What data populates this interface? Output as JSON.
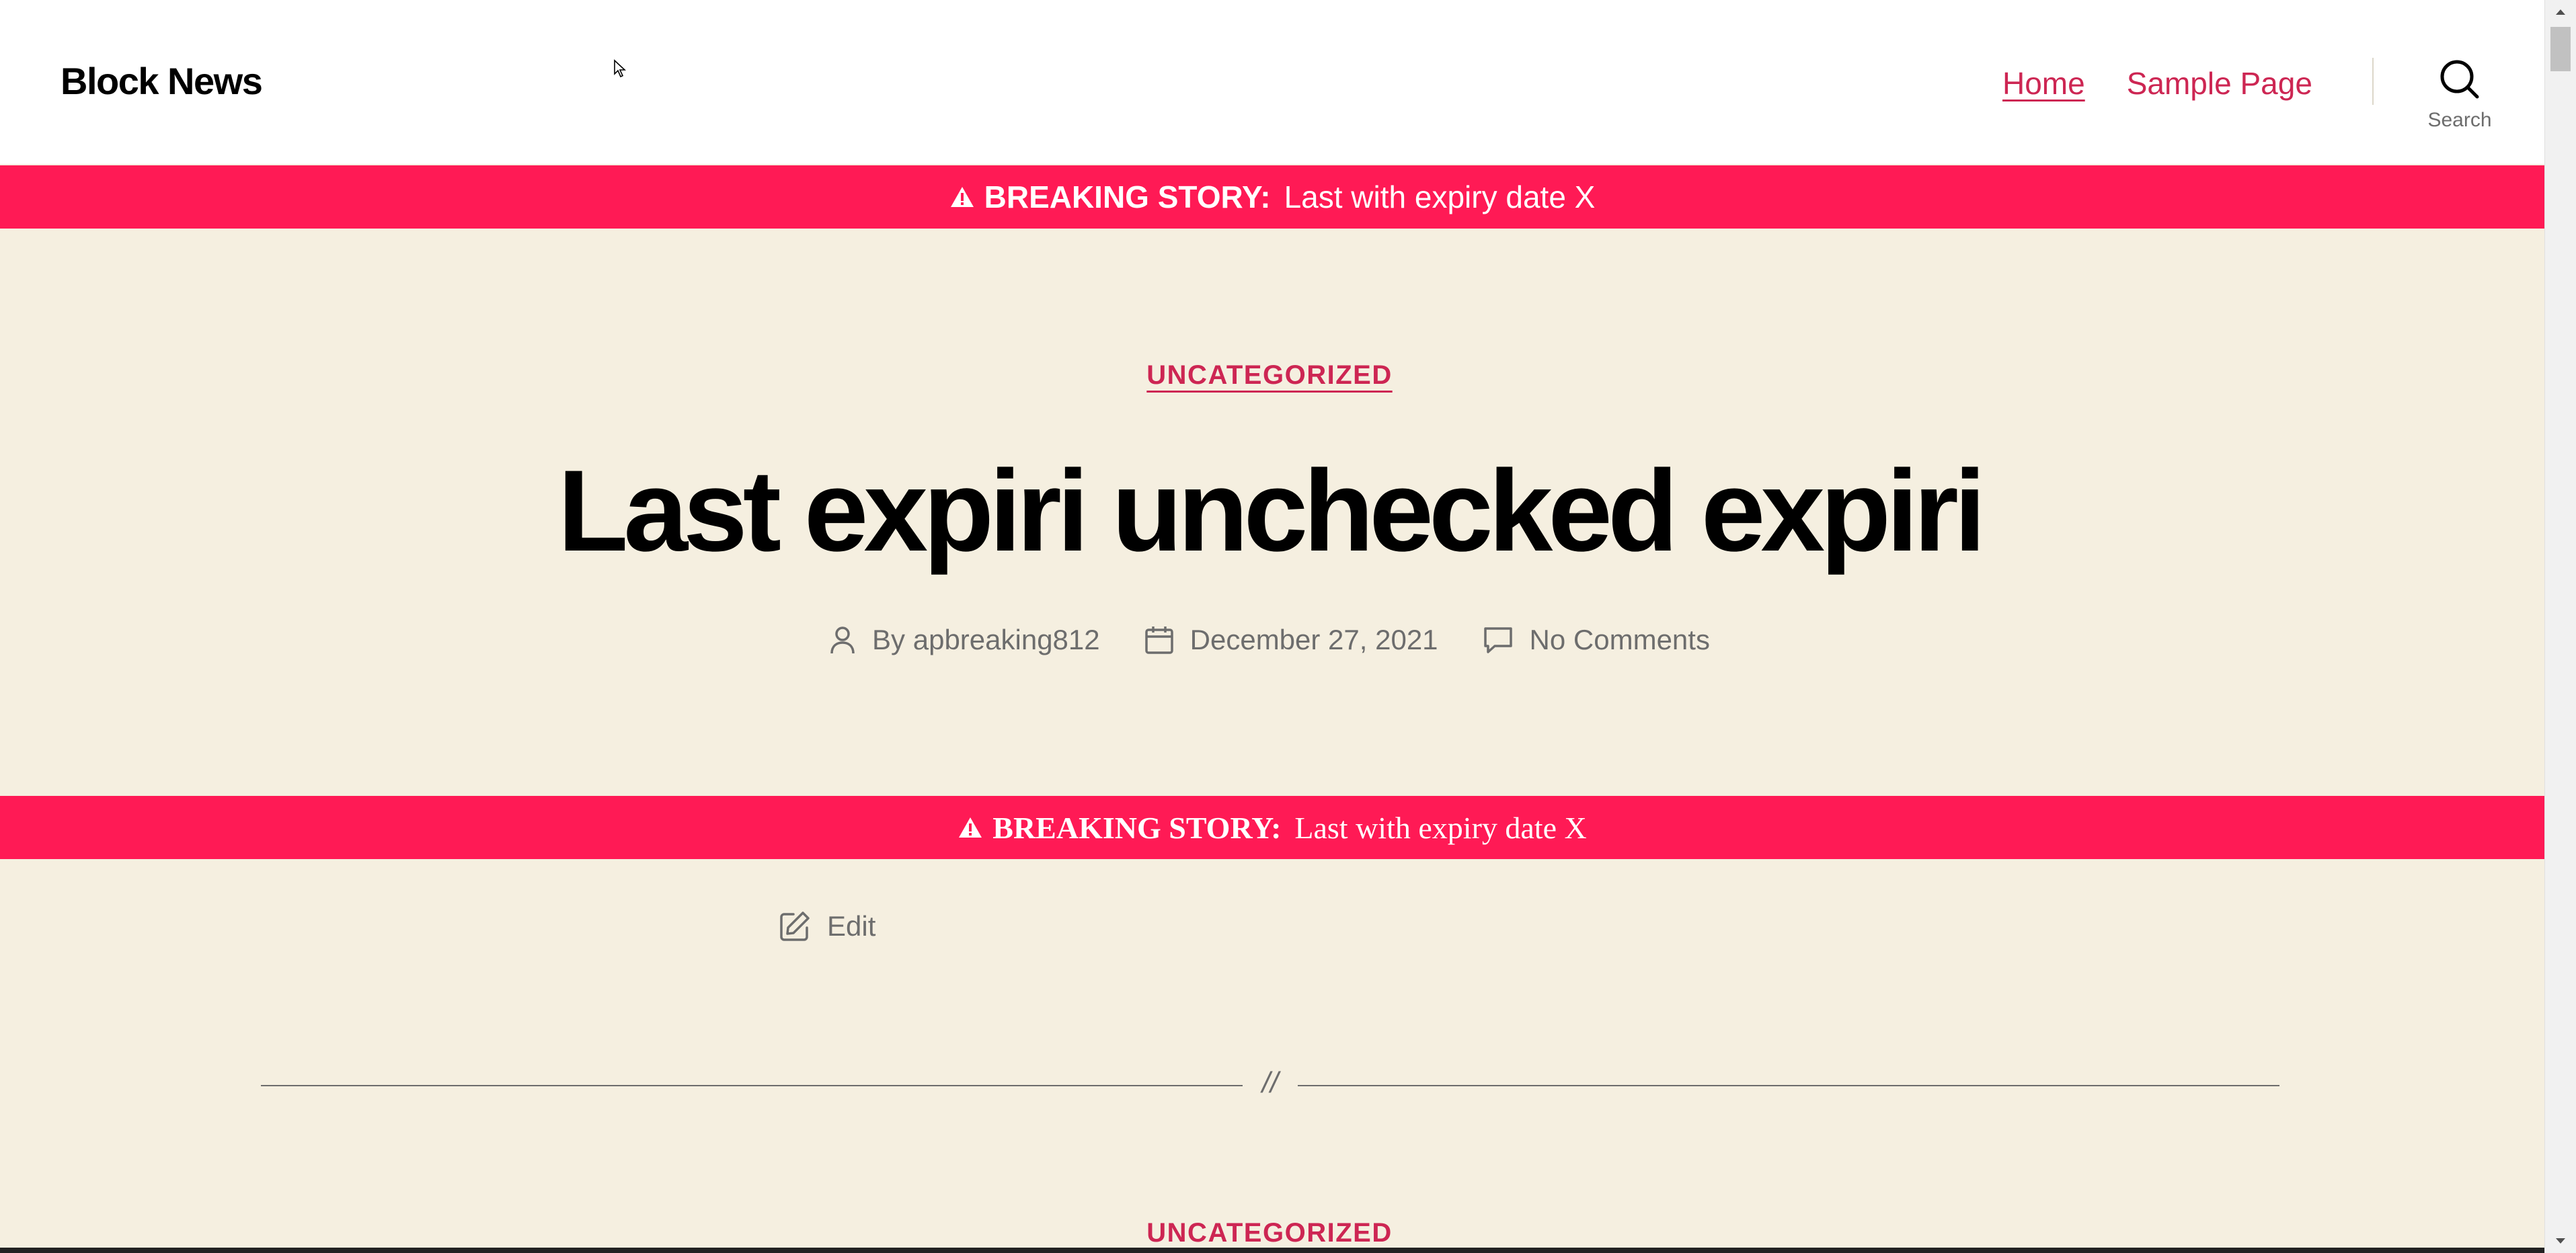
{
  "header": {
    "site_title": "Block News",
    "nav": [
      {
        "label": "Home",
        "current": true
      },
      {
        "label": "Sample Page",
        "current": false
      }
    ],
    "search_label": "Search"
  },
  "breaking": {
    "label": "BREAKING STORY:",
    "text": "Last with expiry date X",
    "icon": "warning-icon",
    "color": "#ff1a55"
  },
  "article": {
    "category": "UNCATEGORIZED",
    "title": "Last expiri unchecked expiri",
    "author_prefix": "By",
    "author": "apbreaking812",
    "date": "December 27, 2021",
    "comments": "No Comments",
    "edit_label": "Edit"
  },
  "separator_text": "//",
  "next_article": {
    "category": "UNCATEGORIZED"
  },
  "colors": {
    "accent": "#cd2653",
    "background": "#f5efe0",
    "header_bg": "#ffffff",
    "meta_text": "#6d6d6d"
  }
}
